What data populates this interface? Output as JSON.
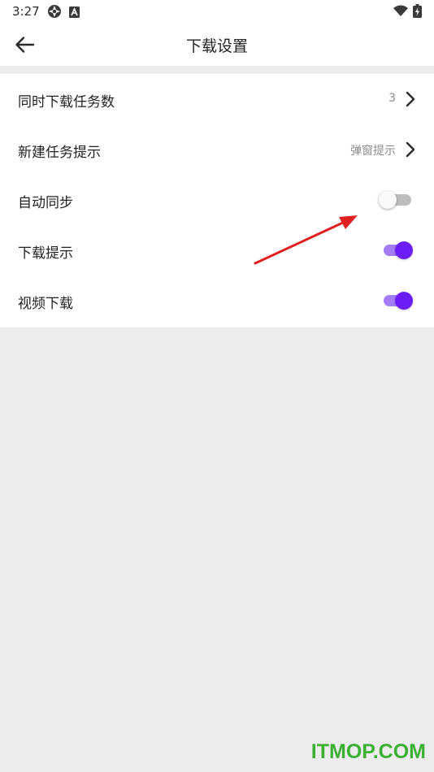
{
  "status_bar": {
    "time": "3:27",
    "icons": [
      "settings-gear-icon",
      "font-a-icon",
      "wifi-icon",
      "battery-charging-icon"
    ]
  },
  "app_bar": {
    "back_icon": "arrow-left-icon",
    "title": "下载设置"
  },
  "settings": [
    {
      "label": "同时下载任务数",
      "value": "3",
      "control": "chevron"
    },
    {
      "label": "新建任务提示",
      "value": "弹窗提示",
      "control": "chevron"
    },
    {
      "label": "自动同步",
      "control": "toggle",
      "on": false
    },
    {
      "label": "下载提示",
      "control": "toggle",
      "on": true
    },
    {
      "label": "视频下载",
      "control": "toggle",
      "on": true
    }
  ],
  "colors": {
    "accent": "#6a1ef5",
    "accent_track": "#a47cf3",
    "toggle_off_track": "#bdbdbd",
    "background": "#ececec",
    "annotation_arrow": "#e02020",
    "watermark": "#3cb034"
  },
  "watermark": "ITMOP.COM"
}
